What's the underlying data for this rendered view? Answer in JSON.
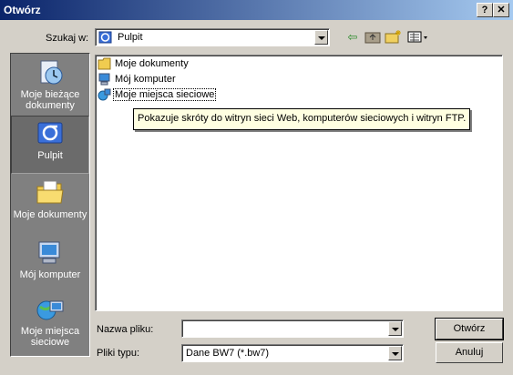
{
  "window": {
    "title": "Otwórz",
    "help_label": "?",
    "close_label": "✕"
  },
  "lookin": {
    "label": "Szukaj w:",
    "value": "Pulpit"
  },
  "places": [
    {
      "label": "Moje bieżące dokumenty",
      "icon": "recent-docs-icon"
    },
    {
      "label": "Pulpit",
      "icon": "desktop-icon"
    },
    {
      "label": "Moje dokumenty",
      "icon": "folder-icon"
    },
    {
      "label": "Mój komputer",
      "icon": "computer-icon"
    },
    {
      "label": "Moje miejsca sieciowe",
      "icon": "network-icon"
    }
  ],
  "files": [
    {
      "label": "Moje dokumenty",
      "icon": "folder-icon"
    },
    {
      "label": "Mój komputer",
      "icon": "computer-icon"
    },
    {
      "label": "Moje miejsca sieciowe",
      "icon": "network-icon"
    }
  ],
  "tooltip": "Pokazuje skróty do witryn sieci Web, komputerów sieciowych i witryn FTP.",
  "filename": {
    "label": "Nazwa pliku:",
    "value": ""
  },
  "filetype": {
    "label": "Pliki typu:",
    "value": "Dane BW7 (*.bw7)"
  },
  "buttons": {
    "open": "Otwórz",
    "cancel": "Anuluj"
  }
}
